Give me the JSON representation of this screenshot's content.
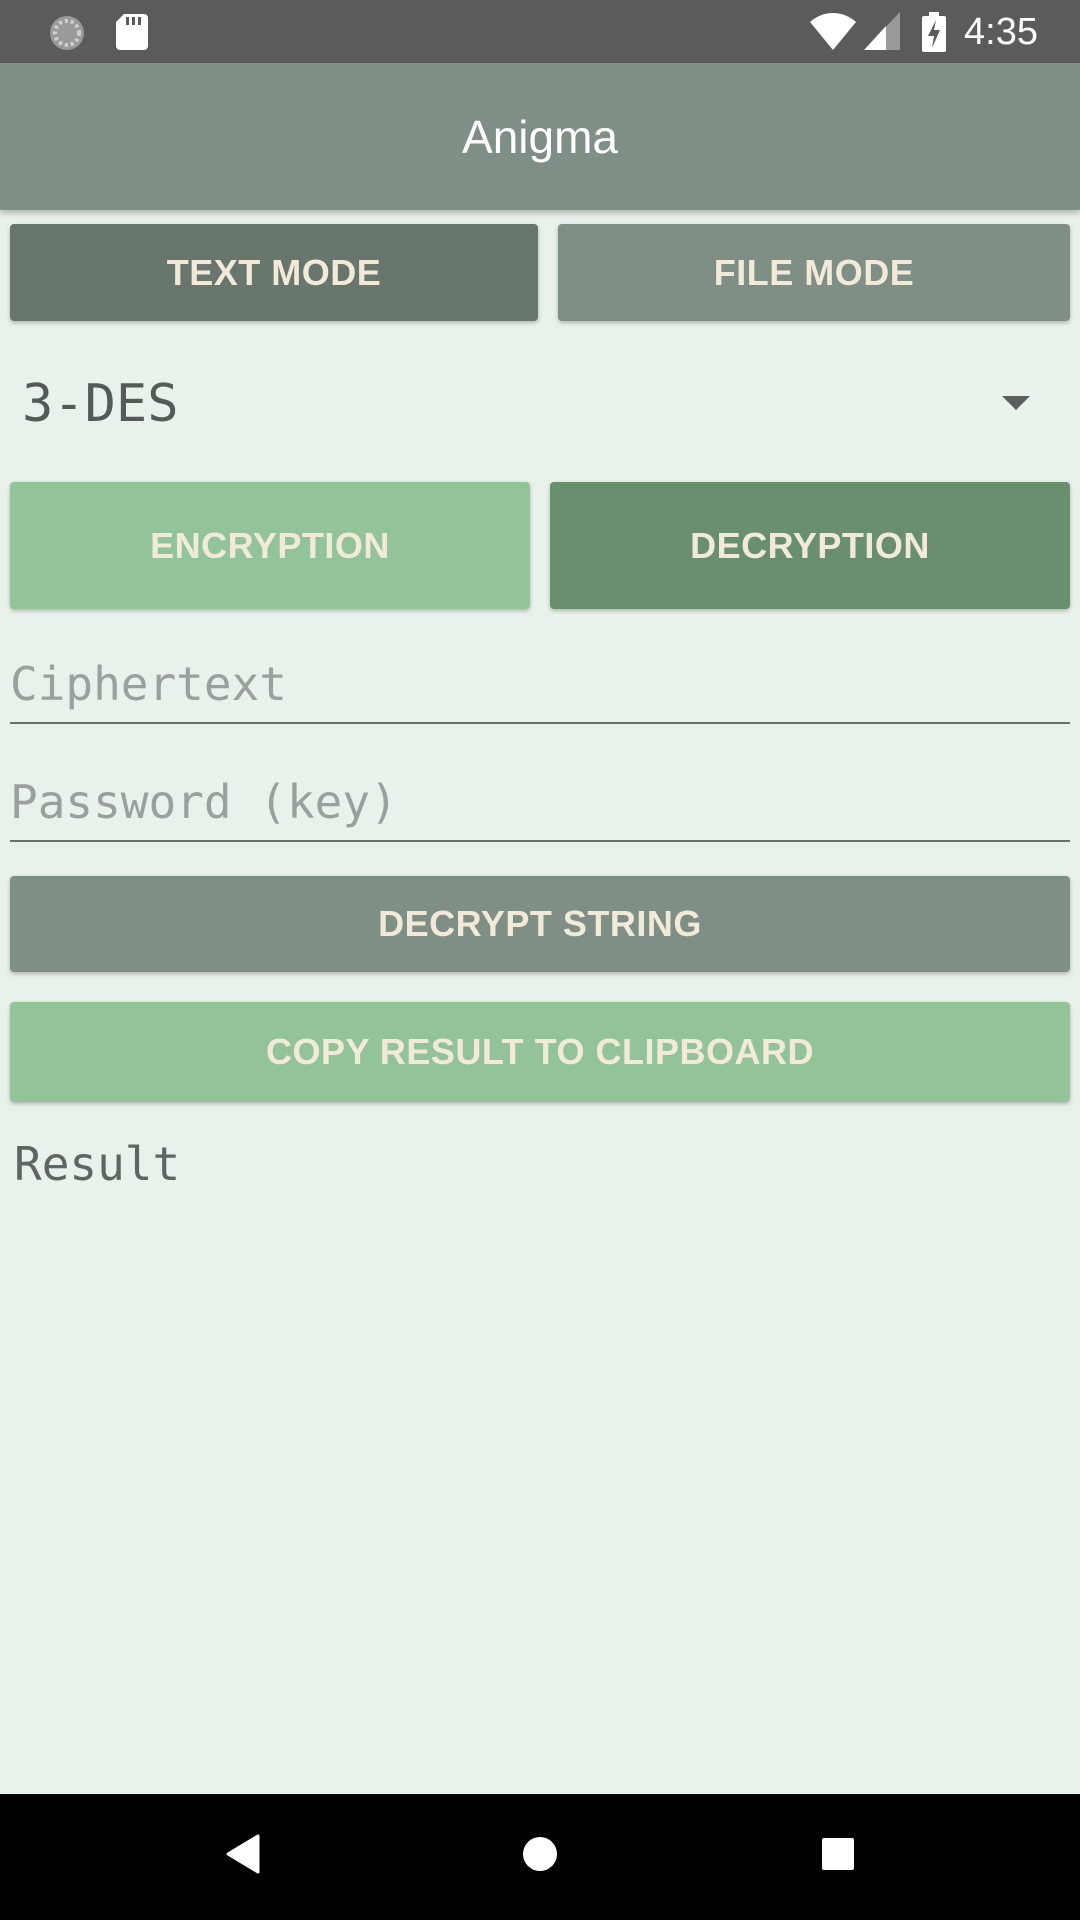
{
  "status_bar": {
    "time": "4:35",
    "left_icons": [
      "sync-icon",
      "sd-card-icon"
    ],
    "right_icons": [
      "wifi-icon",
      "cell-signal-icon",
      "battery-charging-icon"
    ]
  },
  "app_bar": {
    "title": "Anigma"
  },
  "mode_tabs": {
    "text_mode": "TEXT MODE",
    "file_mode": "FILE MODE"
  },
  "algorithm": {
    "selected": "3-DES"
  },
  "operation": {
    "encryption": "ENCRYPTION",
    "decryption": "DECRYPTION"
  },
  "inputs": {
    "ciphertext": {
      "value": "",
      "placeholder": "Ciphertext"
    },
    "password": {
      "value": "",
      "placeholder": "Password (key)"
    }
  },
  "actions": {
    "decrypt": "DECRYPT STRING",
    "copy": "COPY RESULT TO CLIPBOARD"
  },
  "result": {
    "text": "Result"
  },
  "nav_bar": {
    "icons": [
      "back-icon",
      "home-icon",
      "recents-icon"
    ]
  },
  "colors": {
    "background": "#e9f2ea",
    "app_bar": "#7f8f85",
    "active_tab": "#68766d",
    "light_green": "#93c499",
    "dark_green": "#6a8f6e",
    "button_text": "#f1ead9"
  }
}
